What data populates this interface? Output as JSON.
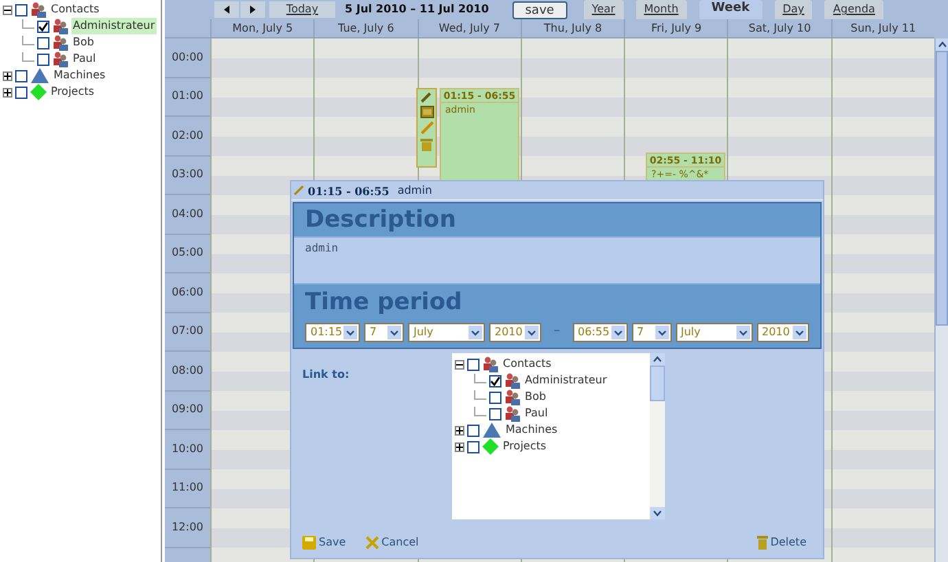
{
  "sidebar_tree": [
    {
      "label": "Contacts",
      "kind": "contacts",
      "expanded": true,
      "checked": false,
      "selected": false,
      "children": [
        {
          "label": "Administrateur",
          "kind": "contacts",
          "checked": true,
          "selected": true
        },
        {
          "label": "Bob",
          "kind": "contacts",
          "checked": false,
          "selected": false
        },
        {
          "label": "Paul",
          "kind": "contacts",
          "checked": false,
          "selected": false
        }
      ]
    },
    {
      "label": "Machines",
      "kind": "machines",
      "expanded": false,
      "checked": false,
      "selected": false
    },
    {
      "label": "Projects",
      "kind": "projects",
      "expanded": false,
      "checked": false,
      "selected": false
    }
  ],
  "toolbar": {
    "today": "Today",
    "date_range": "5 Jul 2010 – 11 Jul 2010",
    "save": "save",
    "view_tabs": [
      {
        "label": "Year",
        "selected": false
      },
      {
        "label": "Month",
        "selected": false
      },
      {
        "label": "Week",
        "selected": true
      },
      {
        "label": "Day",
        "selected": false
      },
      {
        "label": "Agenda",
        "selected": false
      }
    ]
  },
  "calendar": {
    "days": [
      "Mon, July 5",
      "Tue, July 6",
      "Wed, July 7",
      "Thu, July 8",
      "Fri, July 9",
      "Sat, July 10",
      "Sun, July 11"
    ],
    "hours": [
      "00:00",
      "01:00",
      "02:00",
      "03:00",
      "04:00",
      "05:00",
      "06:00",
      "07:00",
      "08:00",
      "09:00",
      "10:00",
      "11:00",
      "12:00"
    ],
    "events": [
      {
        "time": "01:15 - 06:55",
        "text": "admin",
        "actions": true
      },
      {
        "time": "02:55 - 11:10",
        "text": "?+=- %^&*",
        "actions": false
      }
    ]
  },
  "dialog": {
    "title_time": "01:15 - 06:55",
    "title_text": "admin",
    "description_heading": "Description",
    "description": "admin",
    "time_period_heading": "Time period",
    "start": {
      "time": "01:15",
      "day": "7",
      "month": "July",
      "year": "2010"
    },
    "separator": "–",
    "end": {
      "time": "06:55",
      "day": "7",
      "month": "July",
      "year": "2010"
    },
    "link_label": "Link to:",
    "link_tree": [
      {
        "label": "Contacts",
        "kind": "contacts",
        "expanded": true,
        "checked": false,
        "selected": false,
        "children": [
          {
            "label": "Administrateur",
            "kind": "contacts",
            "checked": true,
            "selected": false
          },
          {
            "label": "Bob",
            "kind": "contacts",
            "checked": false,
            "selected": false
          },
          {
            "label": "Paul",
            "kind": "contacts",
            "checked": false,
            "selected": false
          }
        ]
      },
      {
        "label": "Machines",
        "kind": "machines",
        "expanded": false,
        "checked": false,
        "selected": false
      },
      {
        "label": "Projects",
        "kind": "projects",
        "expanded": false,
        "checked": false,
        "selected": false
      }
    ],
    "save": "Save",
    "cancel": "Cancel",
    "delete": "Delete"
  }
}
